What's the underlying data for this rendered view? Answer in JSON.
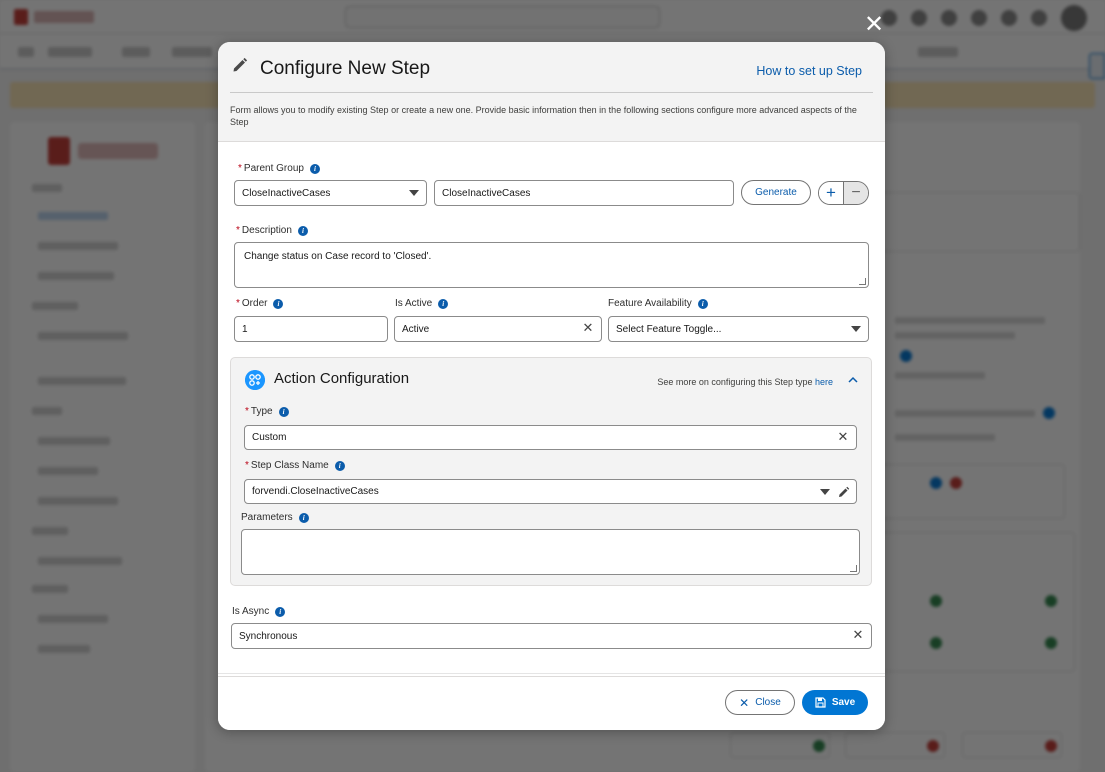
{
  "modal": {
    "title": "Configure New Step",
    "help_link": "How to set up Step",
    "description": "Form allows you to modify existing Step or create a new one. Provide basic information then in the following sections configure more advanced aspects of the Step"
  },
  "form": {
    "parent_group": {
      "label": "Parent Group",
      "selected": "CloseInactiveCases",
      "text_value": "CloseInactiveCases",
      "generate_label": "Generate",
      "add_label": "+",
      "remove_label": "−"
    },
    "description": {
      "label": "Description",
      "value": "Change status on Case record to 'Closed'."
    },
    "order": {
      "label": "Order",
      "value": "1"
    },
    "is_active": {
      "label": "Is Active",
      "value": "Active"
    },
    "feature_availability": {
      "label": "Feature Availability",
      "value": "Select Feature Toggle..."
    },
    "is_async": {
      "label": "Is Async",
      "value": "Synchronous"
    }
  },
  "action_config": {
    "title": "Action Configuration",
    "hint_text": "See more on configuring this Step type ",
    "hint_link": "here",
    "type": {
      "label": "Type",
      "value": "Custom"
    },
    "step_class": {
      "label": "Step Class Name",
      "value": "forvendi.CloseInactiveCases"
    },
    "parameters": {
      "label": "Parameters",
      "value": ""
    }
  },
  "footer": {
    "close_label": "Close",
    "save_label": "Save"
  },
  "colors": {
    "brand": "#0176d3",
    "link": "#0b5cab",
    "required": "#ba0517"
  },
  "icons": {
    "pencil": "pencil-icon",
    "info": "info-icon",
    "close": "close-icon",
    "save": "save-icon",
    "gear": "gear-icon"
  }
}
